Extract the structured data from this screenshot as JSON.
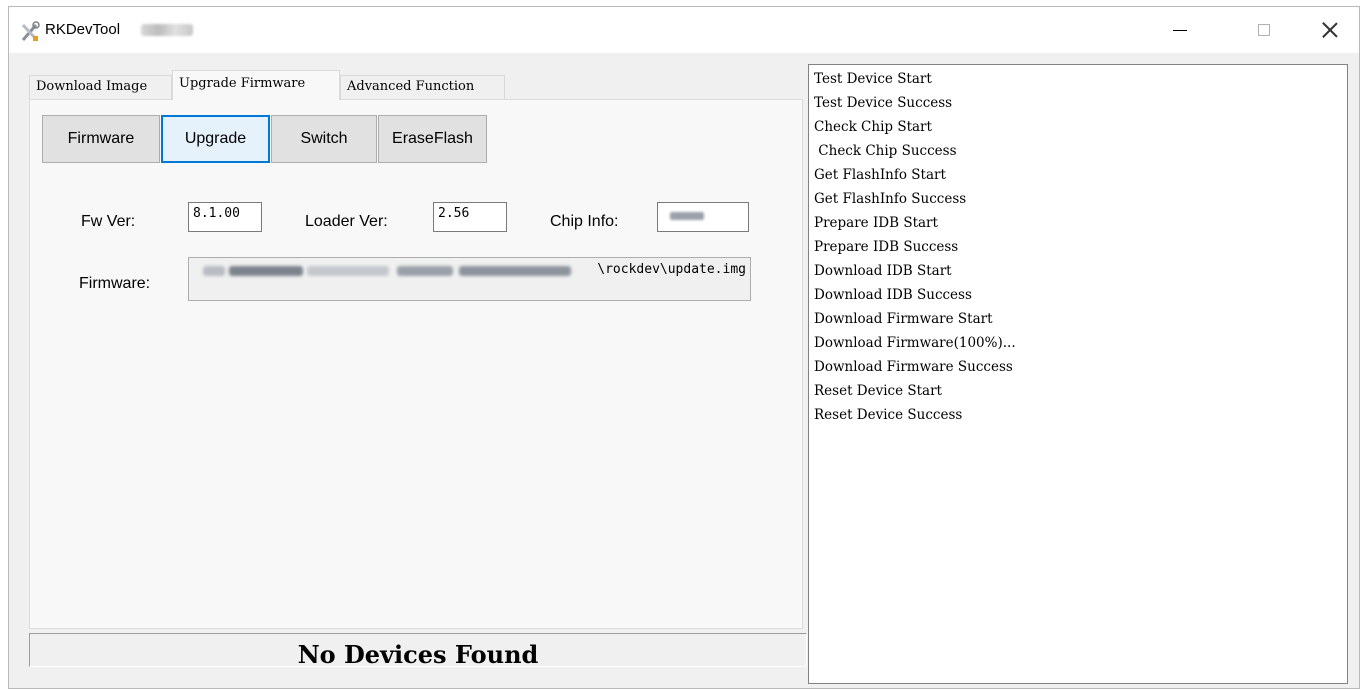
{
  "window": {
    "title": "RKDevTool",
    "controls": {
      "minimize": "—",
      "maximize": "□",
      "close": "✕"
    }
  },
  "tabs": [
    {
      "label": "Download Image",
      "active": false
    },
    {
      "label": "Upgrade Firmware",
      "active": true
    },
    {
      "label": "Advanced Function",
      "active": false
    }
  ],
  "actions": {
    "firmware": "Firmware",
    "upgrade": "Upgrade",
    "switch": "Switch",
    "erase_flash": "EraseFlash"
  },
  "info": {
    "fw_ver_label": "Fw Ver:",
    "fw_ver_value": "8.1.00",
    "loader_ver_label": "Loader Ver:",
    "loader_ver_value": "2.56",
    "chip_info_label": "Chip Info:",
    "firmware_label": "Firmware:",
    "firmware_path_tail": "\\rockdev\\update.img"
  },
  "status": "No Devices Found",
  "log": [
    "Test Device Start",
    "Test Device Success",
    "Check Chip Start",
    " Check Chip Success",
    "Get FlashInfo Start",
    "Get FlashInfo Success",
    "Prepare IDB Start",
    "Prepare IDB Success",
    "Download IDB Start",
    "Download IDB Success",
    "Download Firmware Start",
    "Download Firmware(100%)...",
    "Download Firmware Success",
    "Reset Device Start",
    "Reset Device Success"
  ],
  "colors": {
    "focus_border": "#0078d7",
    "window_bg": "#f0f0f0"
  }
}
